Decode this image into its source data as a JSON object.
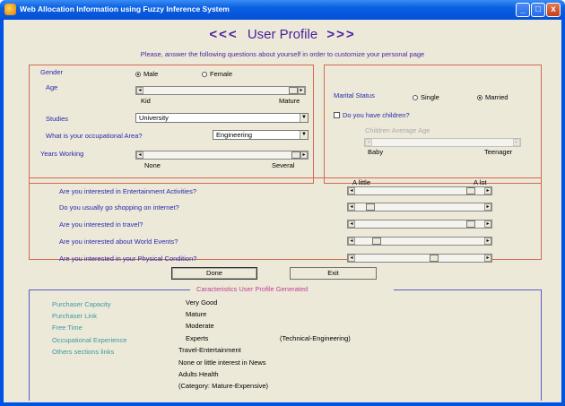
{
  "window": {
    "title": "Web Allocation Information using Fuzzy Inference System",
    "minimize": "_",
    "maximize": "□",
    "close": "x"
  },
  "header": {
    "left_arrows": "<<<",
    "title": "User Profile",
    "right_arrows": ">>>",
    "subtitle": "Please, answer the following questions about yourself in order to customize your personal page"
  },
  "profile": {
    "gender_label": "Gender",
    "gender_options": [
      "Male",
      "Female"
    ],
    "gender_selected": "Male",
    "age_label": "Age",
    "age_min": "Kid",
    "age_max": "Mature",
    "age_value": 1.0,
    "studies_label": "Studies",
    "studies_value": "University",
    "occupation_label": "What is your occupational Area?",
    "occupation_value": "Engineering",
    "years_label": "Years Working",
    "years_min": "None",
    "years_max": "Several",
    "years_value": 1.0
  },
  "family": {
    "marital_label": "Marital Status",
    "marital_options": [
      "Single",
      "Married"
    ],
    "marital_selected": "Married",
    "children_label": "Do you have children?",
    "children_checked": false,
    "children_age_label": "Children Average Age",
    "children_age_min": "Baby",
    "children_age_max": "Teenager"
  },
  "interests": {
    "min_label": "A little",
    "max_label": "A lot",
    "questions": [
      {
        "text": "Are you interested in Entertainment Activities?",
        "value": 0.93
      },
      {
        "text": "Do you usually go shopping on internet?",
        "value": 0.08
      },
      {
        "text": "Are you interested in travel?",
        "value": 0.93
      },
      {
        "text": "Are you interested about World Events?",
        "value": 0.14
      },
      {
        "text": "Are you interested in your Physical Condition?",
        "value": 0.62
      }
    ]
  },
  "buttons": {
    "done": "Done",
    "exit": "Exit"
  },
  "generated": {
    "title": "Caracteristics User Profile Generated",
    "rows": [
      {
        "label": "Purchaser Capacity",
        "value": "Very Good"
      },
      {
        "label": "Purchaser Link",
        "value": "Mature"
      },
      {
        "label": "Free Time",
        "value": "Moderate"
      },
      {
        "label": "Occupational Experience",
        "value": "Experts",
        "extra": "(Technical-Engineering)"
      },
      {
        "label": "Others sections links",
        "value": "Travel-Entertainment"
      }
    ],
    "more_links": [
      "None or little interest in News",
      "Adults Health",
      "(Category: Mature-Expensive)"
    ]
  }
}
